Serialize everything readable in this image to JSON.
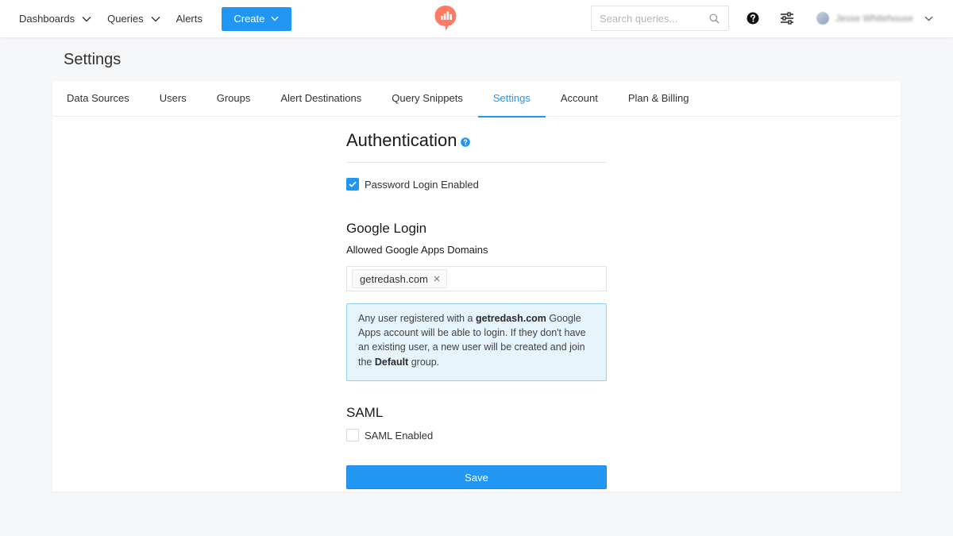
{
  "nav": {
    "dashboards": "Dashboards",
    "queries": "Queries",
    "alerts": "Alerts",
    "create": "Create",
    "search_placeholder": "Search queries...",
    "user_name": "Jesse Whitehouse"
  },
  "page": {
    "title": "Settings"
  },
  "tabs": [
    {
      "label": "Data Sources"
    },
    {
      "label": "Users"
    },
    {
      "label": "Groups"
    },
    {
      "label": "Alert Destinations"
    },
    {
      "label": "Query Snippets"
    },
    {
      "label": "Settings",
      "active": true
    },
    {
      "label": "Account"
    },
    {
      "label": "Plan & Billing"
    }
  ],
  "auth": {
    "heading": "Authentication",
    "password_login_label": "Password Login Enabled",
    "password_login_checked": true
  },
  "google": {
    "heading": "Google Login",
    "domains_label": "Allowed Google Apps Domains",
    "domains": [
      "getredash.com"
    ],
    "info_prefix": "Any user registered with a ",
    "info_domain": "getredash.com",
    "info_middle": " Google Apps account will be able to login. If they don't have an existing user, a new user will be created and join the ",
    "info_group": "Default",
    "info_suffix": " group."
  },
  "saml": {
    "heading": "SAML",
    "enabled_label": "SAML Enabled",
    "enabled_checked": false
  },
  "save_label": "Save",
  "colors": {
    "accent": "#2196f3",
    "info_bg": "#e6f4fb",
    "info_border": "#93d1f2",
    "logo": "#ff7964"
  }
}
